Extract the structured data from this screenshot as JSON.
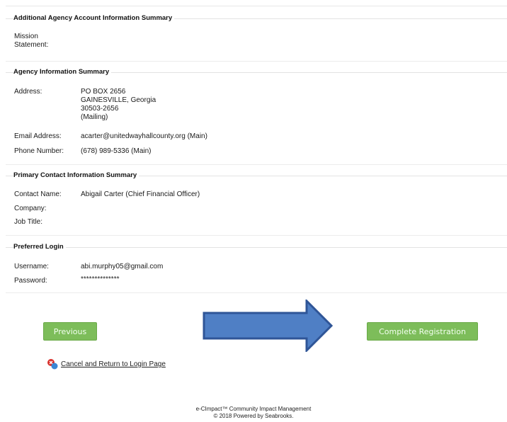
{
  "sections": {
    "additional": {
      "title": "Additional Agency Account Information Summary",
      "mission_label_line1": "Mission",
      "mission_label_line2": "Statement:"
    },
    "agency": {
      "title": "Agency Information Summary",
      "address_label": "Address:",
      "address_lines": [
        "PO BOX 2656",
        "GAINESVILLE, Georgia",
        "30503-2656",
        "(Mailing)"
      ],
      "email_label": "Email Address:",
      "email_value": "acarter@unitedwayhallcounty.org (Main)",
      "phone_label": "Phone Number:",
      "phone_value": "(678) 989-5336 (Main)"
    },
    "contact": {
      "title": "Primary Contact Information Summary",
      "name_label": "Contact Name:",
      "name_value": "Abigail Carter (Chief Financial Officer)",
      "company_label": "Company:",
      "job_label": "Job Title:"
    },
    "login": {
      "title": "Preferred Login",
      "username_label": "Username:",
      "username_value": "abi.murphy05@gmail.com",
      "password_label": "Password:",
      "password_value": "**************"
    }
  },
  "buttons": {
    "previous": "Previous",
    "complete": "Complete Registration",
    "color": "#7dbd5a"
  },
  "cancel_link": "Cancel and Return to Login Page",
  "arrow": {
    "color": "#4f7fc5",
    "icon": "right-arrow-icon"
  },
  "footer": {
    "line1": "e-CImpact™ Community Impact Management",
    "line2": "© 2018 Powered by Seabrooks."
  }
}
